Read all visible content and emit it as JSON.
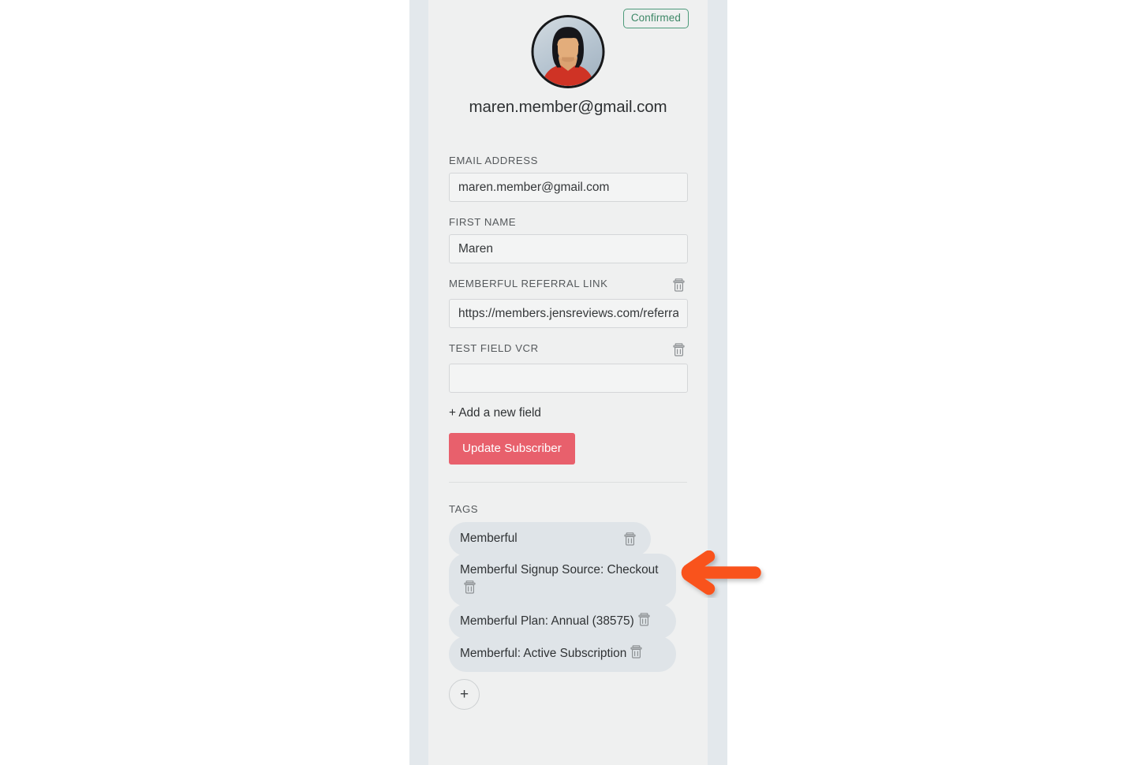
{
  "profile": {
    "status_badge": "Confirmed",
    "email_heading": "maren.member@gmail.com",
    "avatar_icon": "user-avatar-photo"
  },
  "form": {
    "fields": [
      {
        "label": "EMAIL ADDRESS",
        "value": "maren.member@gmail.com",
        "placeholder": "",
        "deletable": false
      },
      {
        "label": "FIRST NAME",
        "value": "Maren",
        "placeholder": "",
        "deletable": false
      },
      {
        "label": "MEMBERFUL REFERRAL LINK",
        "value": "https://members.jensreviews.com/referral",
        "placeholder": "",
        "deletable": true
      },
      {
        "label": "TEST FIELD VCR",
        "value": "",
        "placeholder": "",
        "deletable": true
      }
    ],
    "add_field_label": "+ Add a new field",
    "submit_label": "Update Subscriber",
    "submit_color": "#e8606c",
    "delete_icon": "trash-icon"
  },
  "tags": {
    "heading": "TAGS",
    "items": [
      {
        "label": "Memberful",
        "style": "short"
      },
      {
        "label": "Memberful Signup Source: Checkout",
        "style": "wide"
      },
      {
        "label": "Memberful Plan: Annual (38575)",
        "style": "wide"
      },
      {
        "label": "Memberful: Active Subscription",
        "style": "wide"
      }
    ],
    "add_tag_label": "+",
    "delete_icon": "trash-icon",
    "pill_color": "#dfe4e8"
  },
  "annotation": {
    "arrow_icon": "arrow-left-annotation",
    "arrow_color": "#f9521e"
  },
  "theme": {
    "frame_bg": "#e3e8ec",
    "panel_bg": "#eff0f0",
    "badge_border": "#4c9a7a",
    "badge_text": "#3d8766"
  }
}
